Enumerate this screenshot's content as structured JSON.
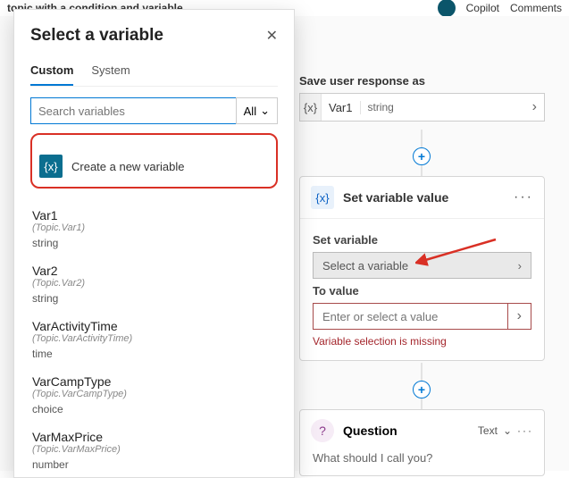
{
  "topbar": {
    "title": "topic with a condition and variable",
    "copilot": "Copilot",
    "comments": "Comments"
  },
  "saveResponse": {
    "label": "Save user response as",
    "varIcon": "{x}",
    "varName": "Var1",
    "varType": "string"
  },
  "setVar": {
    "icon": "{x}",
    "title": "Set variable value",
    "fieldLabel": "Set variable",
    "selectPlaceholder": "Select a variable",
    "toLabel": "To value",
    "toPlaceholder": "Enter or select a value",
    "error": "Variable selection is missing"
  },
  "question": {
    "title": "Question",
    "typeLabel": "Text",
    "prompt": "What should I call you?"
  },
  "panel": {
    "title": "Select a variable",
    "tabCustom": "Custom",
    "tabSystem": "System",
    "searchPlaceholder": "Search variables",
    "filterLabel": "All",
    "createLabel": "Create a new variable",
    "createIcon": "{x}",
    "vars": [
      {
        "name": "Var1",
        "ref": "(Topic.Var1)",
        "type": "string"
      },
      {
        "name": "Var2",
        "ref": "(Topic.Var2)",
        "type": "string"
      },
      {
        "name": "VarActivityTime",
        "ref": "(Topic.VarActivityTime)",
        "type": "time"
      },
      {
        "name": "VarCampType",
        "ref": "(Topic.VarCampType)",
        "type": "choice"
      },
      {
        "name": "VarMaxPrice",
        "ref": "(Topic.VarMaxPrice)",
        "type": "number"
      }
    ]
  }
}
